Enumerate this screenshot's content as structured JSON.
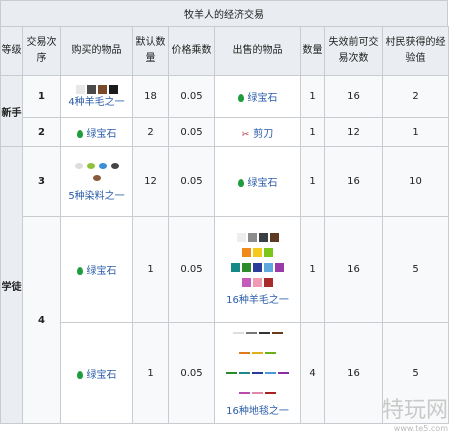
{
  "title": "牧羊人的经济交易",
  "headers": {
    "level": "等级",
    "order": "交易次序",
    "buy": "购买的物品",
    "default_qty": "默认数量",
    "price_mult": "价格乘数",
    "sell": "出售的物品",
    "qty": "数量",
    "max_trades": "失效前可交易次数",
    "xp": "村民获得的经验值"
  },
  "levels": {
    "novice": "新手",
    "apprentice": "学徒"
  },
  "rows": [
    {
      "order": "1",
      "buy": "4种羊毛之一",
      "default_qty": "18",
      "price_mult": "0.05",
      "sell": "绿宝石",
      "qty": "1",
      "max_trades": "16",
      "xp": "2"
    },
    {
      "order": "2",
      "buy": "绿宝石",
      "default_qty": "2",
      "price_mult": "0.05",
      "sell": "剪刀",
      "qty": "1",
      "max_trades": "12",
      "xp": "1"
    },
    {
      "order": "3",
      "buy": "5种染料之一",
      "default_qty": "12",
      "price_mult": "0.05",
      "sell": "绿宝石",
      "qty": "1",
      "max_trades": "16",
      "xp": "10"
    },
    {
      "order": "4",
      "buy": "绿宝石",
      "default_qty": "1",
      "price_mult": "0.05",
      "sell": "16种羊毛之一",
      "qty": "1",
      "max_trades": "16",
      "xp": "5"
    },
    {
      "order": "",
      "buy": "绿宝石",
      "default_qty": "1",
      "price_mult": "0.05",
      "sell": "16种地毯之一",
      "qty": "4",
      "max_trades": "16",
      "xp": "5"
    }
  ],
  "colors": {
    "wool_4": [
      "#e8e8e8",
      "#4a4a4a",
      "#7a4a2a",
      "#1a1a1a"
    ],
    "dyes_5": [
      "#dddddd",
      "#8fc23a",
      "#3b8fd8",
      "#444444",
      "#8a5a3a"
    ],
    "wool_16": [
      "#eeeeee",
      "#8c8c8c",
      "#3a3f44",
      "#5e3a22",
      "#f08a1a",
      "#f4cb1a",
      "#7cc61a",
      "#2c8c2a",
      "#178888",
      "#2c3c9a",
      "#5ea8e0",
      "#9a3aa8",
      "#c45abc",
      "#f09ab4",
      "#a82a2a",
      "#1a1a1a"
    ],
    "carpet_16": [
      "#dddddd",
      "#777777",
      "#333333",
      "#6a3a1a",
      "#e07a1a",
      "#e0b01a",
      "#6ab01a",
      "#2a8a2a",
      "#1a8a8a",
      "#2a3a9a",
      "#4a9ad8",
      "#8a2aa8",
      "#b84ab0",
      "#e08aa8",
      "#aa2222",
      "#222222"
    ]
  },
  "watermark": {
    "main": "特玩网",
    "sub": "www.te5.com"
  }
}
